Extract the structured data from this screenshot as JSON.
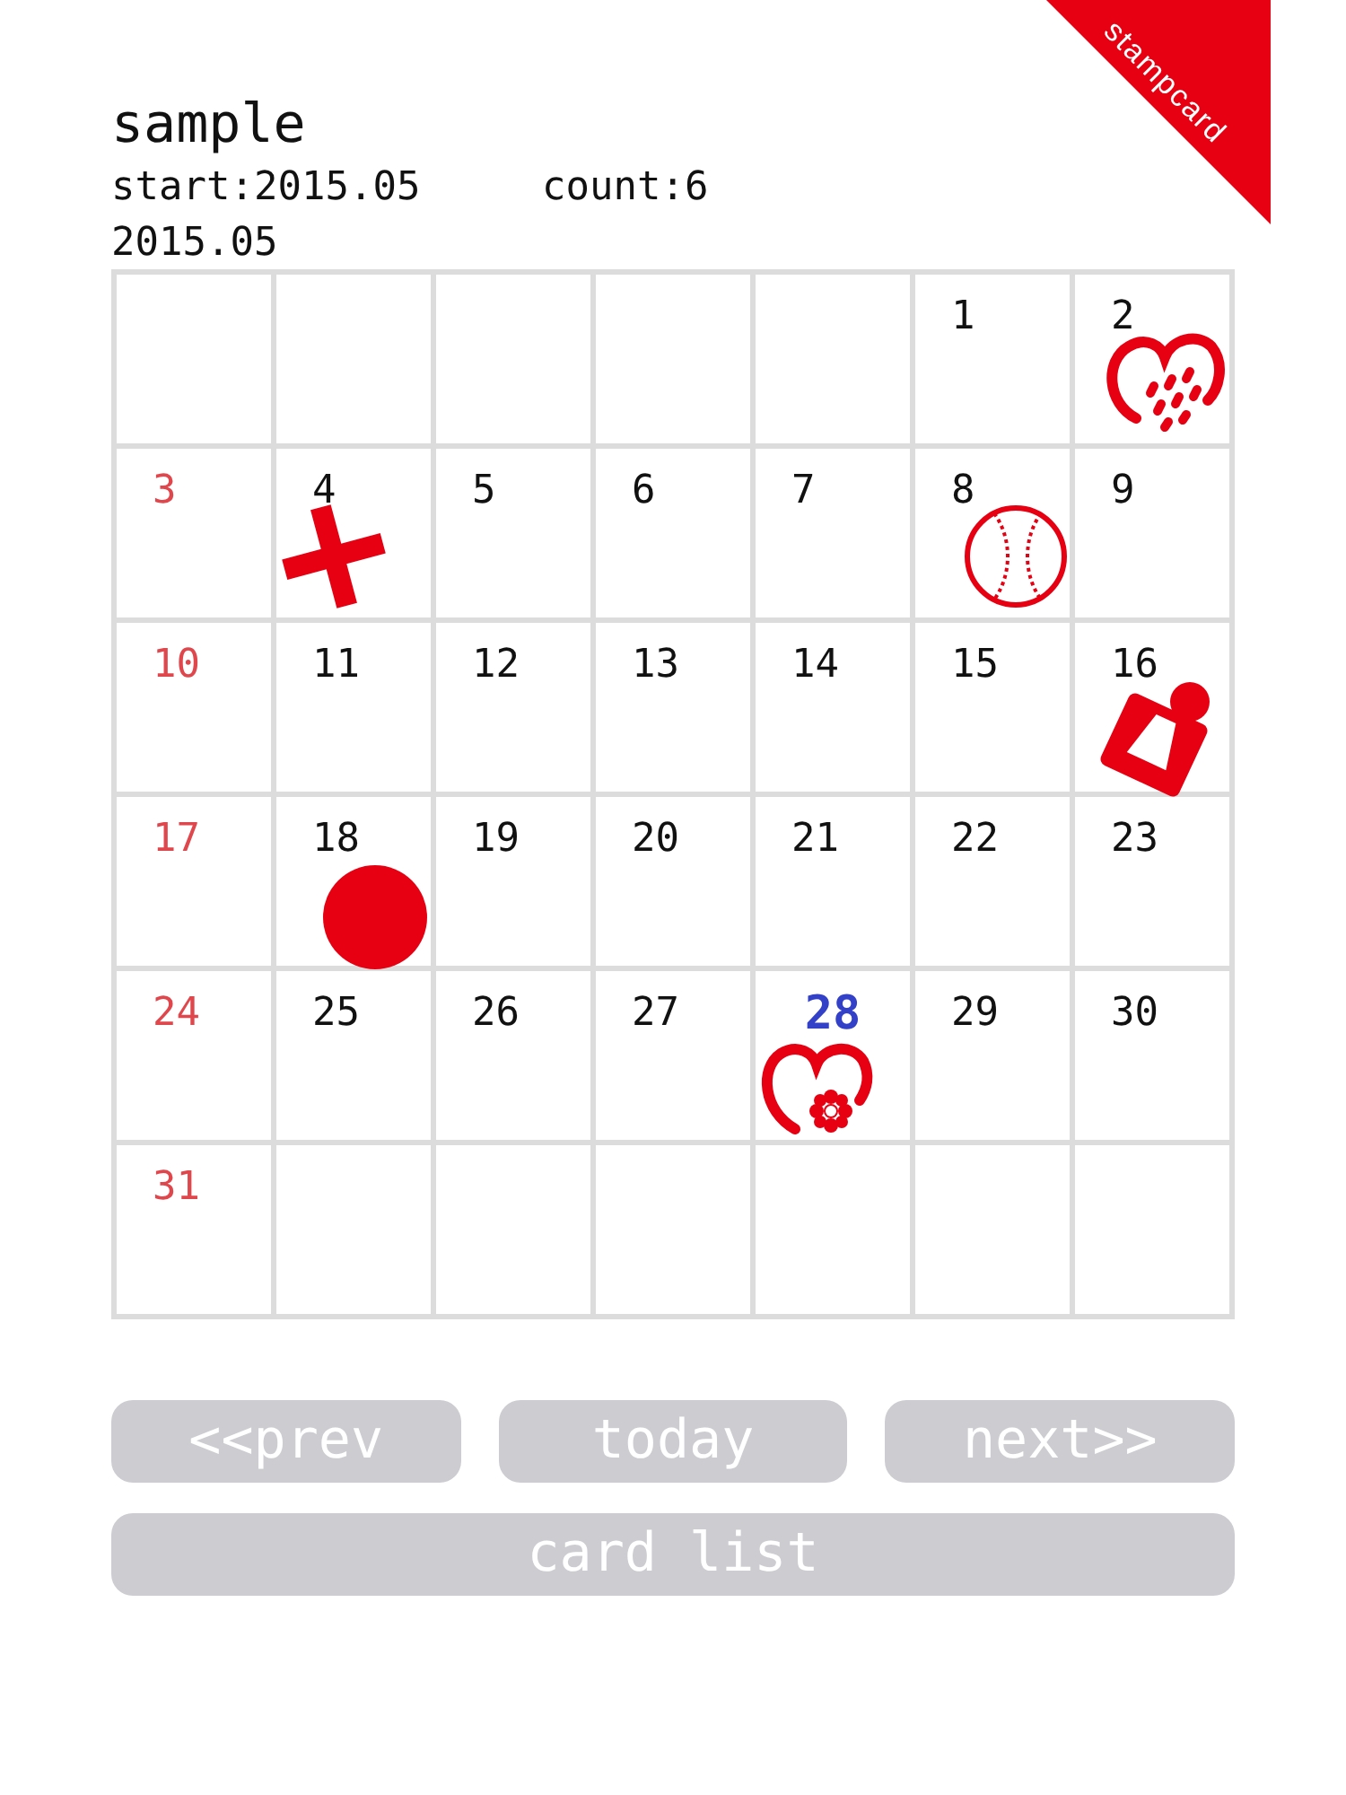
{
  "ribbon": {
    "label": "stampcard"
  },
  "card": {
    "title": "sample",
    "start": "start:2015.05",
    "count": "count:6"
  },
  "calendar": {
    "month": "2015.05",
    "cells": [
      {
        "kind": "blank"
      },
      {
        "kind": "blank"
      },
      {
        "kind": "blank"
      },
      {
        "kind": "blank"
      },
      {
        "kind": "blank"
      },
      {
        "day": "1",
        "kind": "weekday",
        "today": false
      },
      {
        "day": "2",
        "kind": "weekday",
        "today": false,
        "stamp": {
          "kind": "rain-heart"
        }
      },
      {
        "day": "3",
        "kind": "sunday",
        "today": false
      },
      {
        "day": "4",
        "kind": "weekday",
        "today": false,
        "stamp": {
          "kind": "cross"
        }
      },
      {
        "day": "5",
        "kind": "weekday",
        "today": false
      },
      {
        "day": "6",
        "kind": "weekday",
        "today": false
      },
      {
        "day": "7",
        "kind": "weekday",
        "today": false
      },
      {
        "day": "8",
        "kind": "weekday",
        "today": false,
        "stamp": {
          "kind": "baseball"
        }
      },
      {
        "day": "9",
        "kind": "weekday",
        "today": false
      },
      {
        "day": "10",
        "kind": "sunday",
        "today": false
      },
      {
        "day": "11",
        "kind": "weekday",
        "today": false
      },
      {
        "day": "12",
        "kind": "weekday",
        "today": false
      },
      {
        "day": "13",
        "kind": "weekday",
        "today": false
      },
      {
        "day": "14",
        "kind": "weekday",
        "today": false
      },
      {
        "day": "15",
        "kind": "weekday",
        "today": false
      },
      {
        "day": "16",
        "kind": "weekday",
        "today": false,
        "stamp": {
          "kind": "tag"
        }
      },
      {
        "day": "17",
        "kind": "sunday",
        "today": false
      },
      {
        "day": "18",
        "kind": "weekday",
        "today": false,
        "stamp": {
          "kind": "dot"
        }
      },
      {
        "day": "19",
        "kind": "weekday",
        "today": false
      },
      {
        "day": "20",
        "kind": "weekday",
        "today": false
      },
      {
        "day": "21",
        "kind": "weekday",
        "today": false
      },
      {
        "day": "22",
        "kind": "weekday",
        "today": false
      },
      {
        "day": "23",
        "kind": "weekday",
        "today": false
      },
      {
        "day": "24",
        "kind": "sunday",
        "today": false
      },
      {
        "day": "25",
        "kind": "weekday",
        "today": false
      },
      {
        "day": "26",
        "kind": "weekday",
        "today": false
      },
      {
        "day": "27",
        "kind": "weekday",
        "today": false
      },
      {
        "day": "28",
        "kind": "weekday",
        "today": true,
        "stamp": {
          "kind": "flower-heart"
        }
      },
      {
        "day": "29",
        "kind": "weekday",
        "today": false
      },
      {
        "day": "30",
        "kind": "weekday",
        "today": false
      },
      {
        "day": "31",
        "kind": "sunday",
        "today": false
      },
      {
        "kind": "blank"
      },
      {
        "kind": "blank"
      },
      {
        "kind": "blank"
      },
      {
        "kind": "blank"
      },
      {
        "kind": "blank"
      },
      {
        "kind": "blank"
      }
    ]
  },
  "buttons": [
    {
      "label": "<<prev",
      "kind": "small"
    },
    {
      "label": "today",
      "kind": "small"
    },
    {
      "label": "next>>",
      "kind": "small"
    },
    {
      "label": "card list",
      "kind": "wide"
    }
  ]
}
